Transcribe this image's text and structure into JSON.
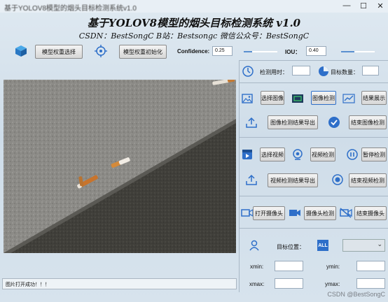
{
  "window": {
    "title": "基于YOLOV8模型的烟头目标检测系统v1.0",
    "minimize": "—",
    "maximize": "☐",
    "close": "✕"
  },
  "header": {
    "title": "基于YOLOV8模型的烟头目标检测系统 v1.0",
    "subtitle": "CSDN：BestSongC   B站：Bestsongc   微信公众号：BestSongC"
  },
  "toolbar": {
    "model_select": "模型权重选择",
    "model_init": "模型权重初始化",
    "confidence_label": "Confidence:",
    "confidence_value": "0.25",
    "confidence_level": 0.25,
    "iou_label": "IOU：",
    "iou_value": "0.40",
    "iou_level": 0.4
  },
  "stats": {
    "time_label": "检测用时：",
    "count_label": "目标数量："
  },
  "image": {
    "select": "选择图像",
    "detect": "图像检测",
    "show_result": "结果展示",
    "export": "图像检测结果导出",
    "end": "结束图像检测"
  },
  "video": {
    "select": "选择视频",
    "detect": "视频检测",
    "pause": "暂停检测",
    "export": "视频检测结果导出",
    "end": "结束视频检测"
  },
  "camera": {
    "open": "打开摄像头",
    "detect": "摄像头检测",
    "end": "结束摄像头"
  },
  "target": {
    "position_label": "目标位置：",
    "all_icon": "ALL",
    "xmin": "xmin:",
    "ymin": "ymin:",
    "xmax": "xmax:",
    "ymax": "ymax:"
  },
  "status": {
    "message": "图片打开成功！！！"
  },
  "watermark": "CSDN @BestSongC",
  "colors": {
    "accent": "#2e6fc9",
    "background": "#d7e3ed"
  }
}
